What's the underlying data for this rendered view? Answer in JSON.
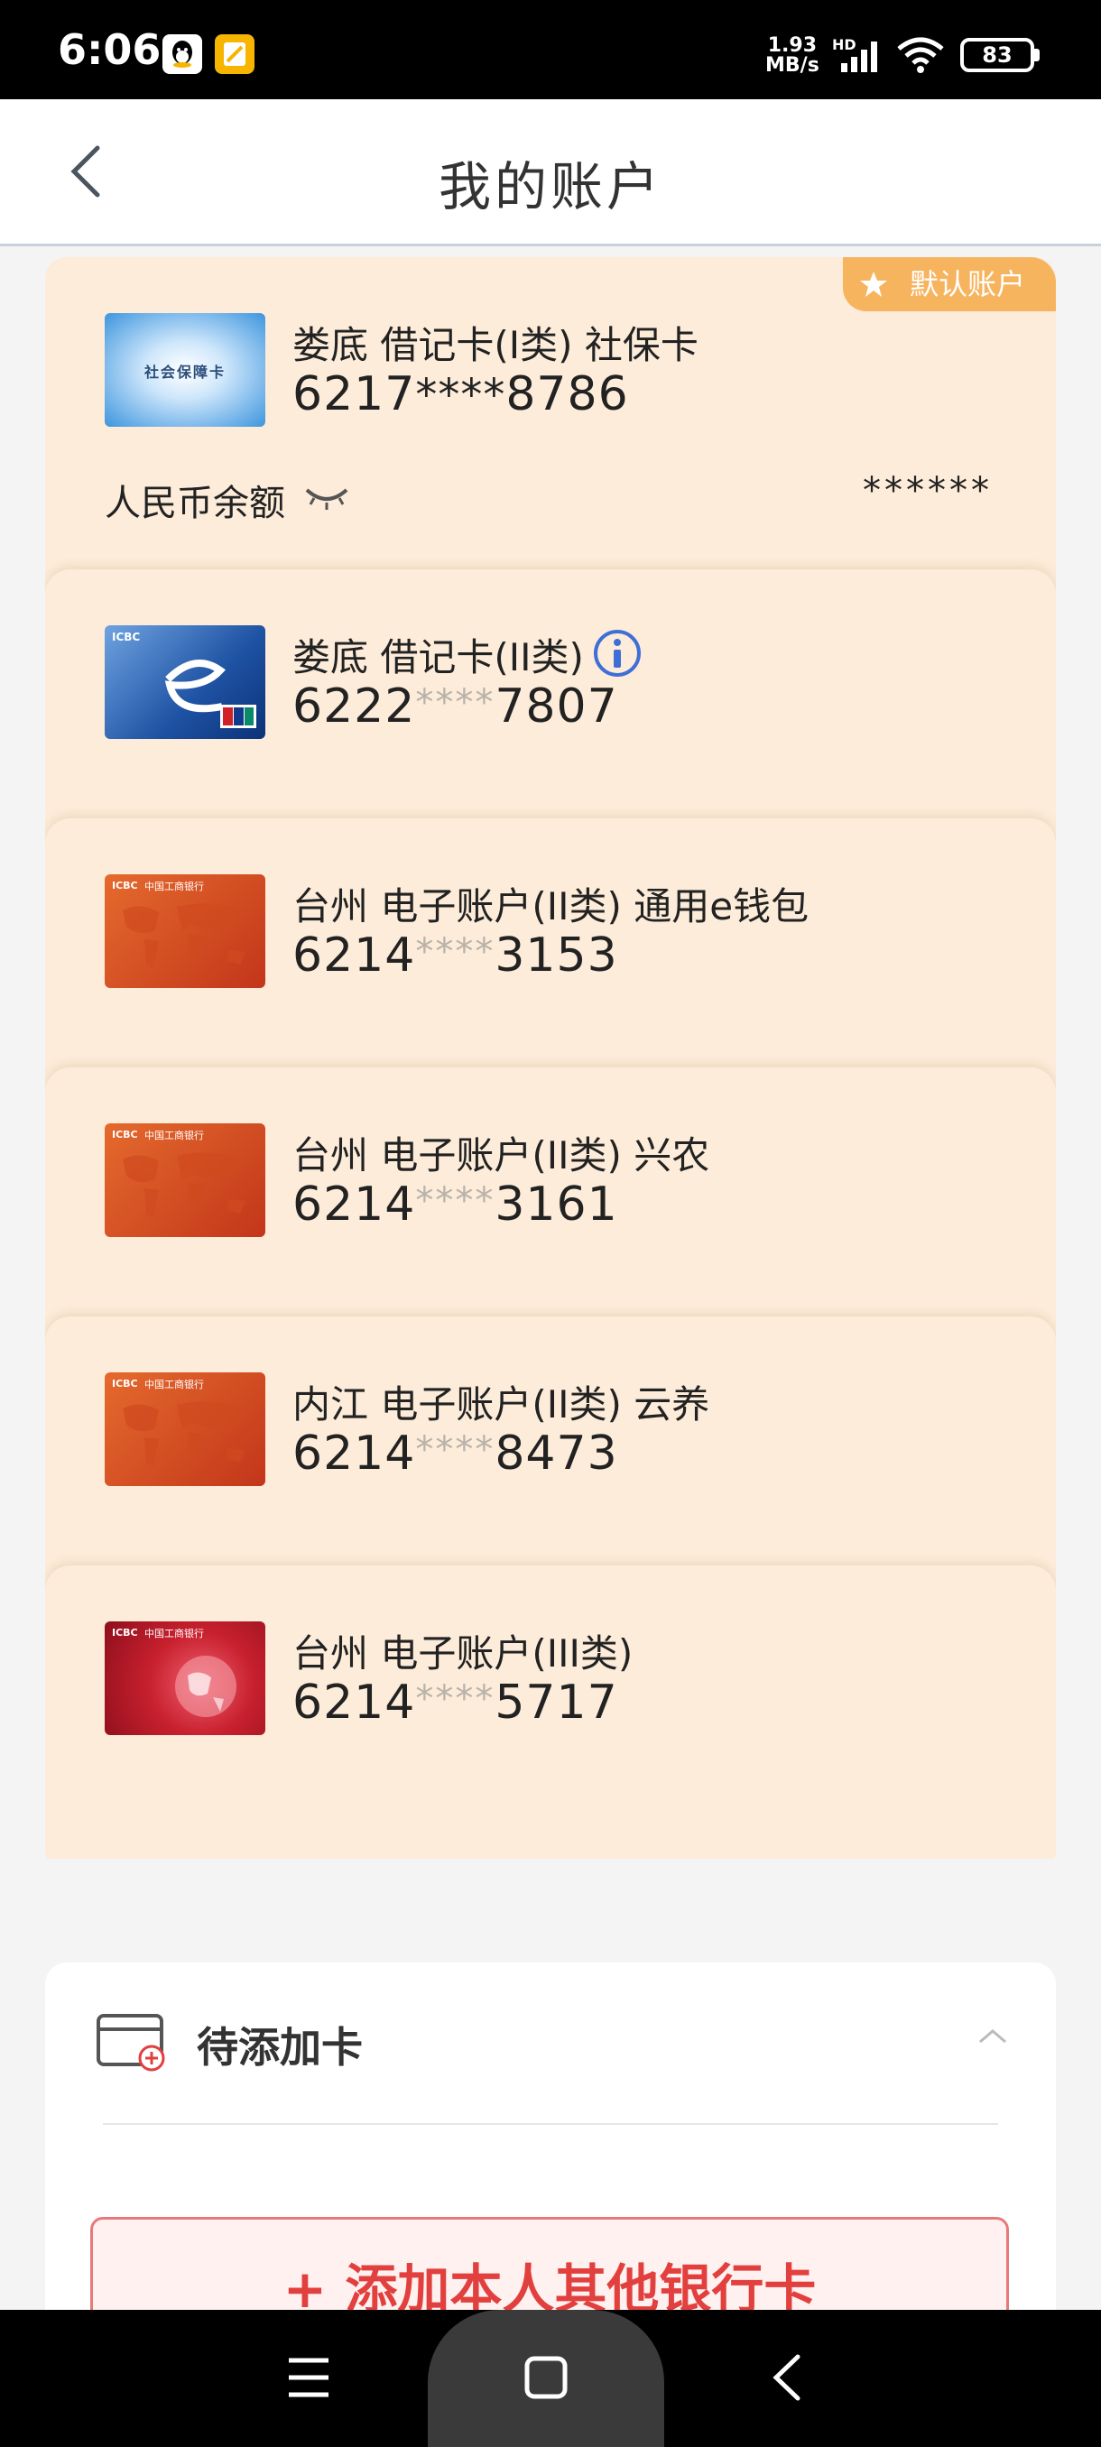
{
  "status_bar": {
    "time": "6:06",
    "net_speed_value": "1.93",
    "net_speed_unit": "MB/s",
    "network_label": "HD",
    "battery": "83"
  },
  "header": {
    "title": "我的账户"
  },
  "accounts": [
    {
      "name": "娄底 借记卡(I类)  社保卡",
      "prefix": "6217",
      "mask": "****",
      "suffix": "8786",
      "thumb_text": "社会保障卡",
      "default_badge": "默认账户",
      "balance_label": "人民币余额",
      "balance_value": "******"
    },
    {
      "name": "娄底 借记卡(II类)",
      "prefix": "6222",
      "mask": "****",
      "suffix": "7807"
    },
    {
      "name": "台州 电子账户(II类) 通用e钱包",
      "prefix": "6214",
      "mask": "****",
      "suffix": "3153"
    },
    {
      "name": "台州 电子账户(II类) 兴农",
      "prefix": "6214",
      "mask": "****",
      "suffix": "3161"
    },
    {
      "name": "内江 电子账户(II类) 云养",
      "prefix": "6214",
      "mask": "****",
      "suffix": "8473"
    },
    {
      "name": "台州 电子账户(III类)",
      "prefix": "6214",
      "mask": "****",
      "suffix": "5717"
    }
  ],
  "card_logo_text": "ICBC",
  "card_bank_text": "中国工商银行",
  "pending": {
    "title": "待添加卡",
    "add_button": "+ 添加本人其他银行卡"
  },
  "colors": {
    "card_bg": "#fcecd9",
    "badge": "#f7b45f",
    "add_button_text": "#e1403e",
    "info_icon": "#3f6fd6"
  }
}
